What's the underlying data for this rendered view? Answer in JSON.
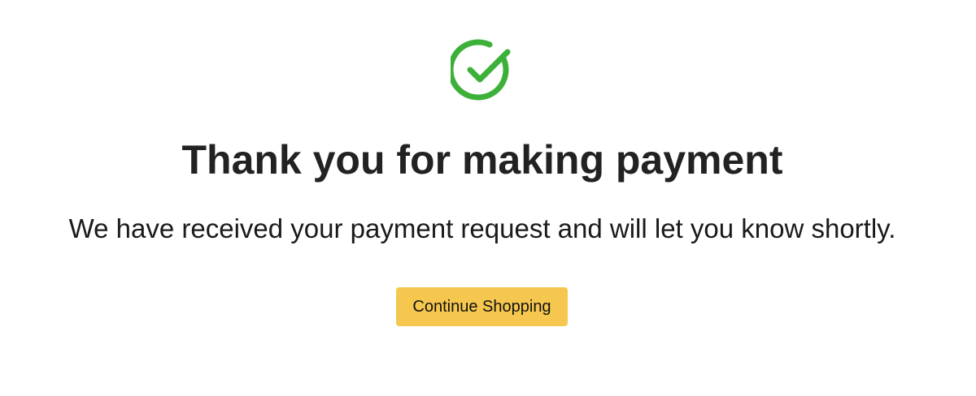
{
  "confirmation": {
    "icon": "check-circle-icon",
    "title": "Thank you for making payment",
    "message": "We have received your payment request and will let you know shortly.",
    "button_label": "Continue Shopping"
  },
  "colors": {
    "success": "#3db03a",
    "button_bg": "#f5c74e",
    "text": "#222222"
  }
}
